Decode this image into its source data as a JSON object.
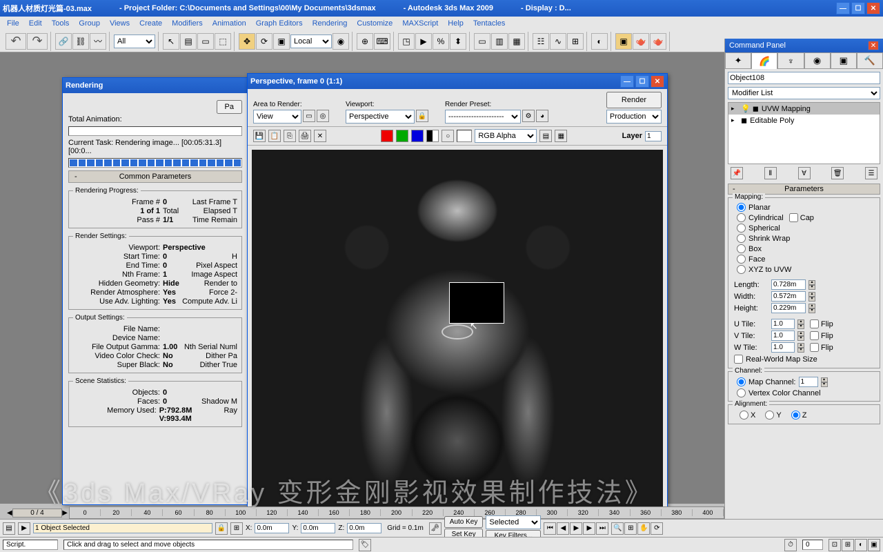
{
  "title": {
    "file": "机器人材质灯光篇-03.max",
    "folder": "- Project Folder: C:\\Documents and Settings\\00\\My Documents\\3dsmax",
    "app": "- Autodesk 3ds Max  2009",
    "display": "- Display : D..."
  },
  "menu": [
    "File",
    "Edit",
    "Tools",
    "Group",
    "Views",
    "Create",
    "Modifiers",
    "Animation",
    "Graph Editors",
    "Rendering",
    "Customize",
    "MAXScript",
    "Help",
    "Tentacles"
  ],
  "toolbar": {
    "sel_filter": "All",
    "coord_sys": "Local"
  },
  "command_panel": {
    "title": "Command Panel",
    "object_name": "Object108",
    "modifier_list": "Modifier List",
    "stack": [
      "UVW Mapping",
      "Editable Poly"
    ],
    "rollout": "Parameters",
    "mapping_label": "Mapping:",
    "mapping_options": [
      "Planar",
      "Cylindrical",
      "Spherical",
      "Shrink Wrap",
      "Box",
      "Face",
      "XYZ to UVW"
    ],
    "cap": "Cap",
    "length_l": "Length:",
    "length_v": "0.728m",
    "width_l": "Width:",
    "width_v": "0.572m",
    "height_l": "Height:",
    "height_v": "0.229m",
    "utile_l": "U Tile:",
    "utile_v": "1.0",
    "vtile_l": "V Tile:",
    "vtile_v": "1.0",
    "wtile_l": "W Tile:",
    "wtile_v": "1.0",
    "flip": "Flip",
    "rwms": "Real-World Map Size",
    "channel_label": "Channel:",
    "map_channel": "Map Channel:",
    "map_channel_v": "1",
    "vertex_color": "Vertex Color Channel",
    "alignment": "Alignment:",
    "axes": [
      "X",
      "Y",
      "Z"
    ]
  },
  "rendering": {
    "title": "Rendering",
    "pause": "Pa",
    "total_anim": "Total Animation:",
    "current_task_l": "Current Task:",
    "current_task_v": "Rendering image... [00:05:31.3] [00:0...",
    "common_params": "Common Parameters",
    "progress_group": "Rendering Progress:",
    "frame_l": "Frame #",
    "frame_v": "0",
    "last_frame": "Last Frame T",
    "of_l": "1 of 1",
    "total_l": "Total",
    "elapsed": "Elapsed T",
    "pass_l": "Pass #",
    "pass_v": "1/1",
    "time_remain": "Time Remain",
    "settings_group": "Render Settings:",
    "viewport_l": "Viewport:",
    "viewport_v": "Perspective",
    "start_l": "Start Time:",
    "start_v": "0",
    "h": "H",
    "end_l": "End Time:",
    "end_v": "0",
    "pixel_aspect": "Pixel Aspect",
    "nth_l": "Nth Frame:",
    "nth_v": "1",
    "image_aspect": "Image Aspect",
    "hidden_l": "Hidden Geometry:",
    "hidden_v": "Hide",
    "render_to": "Render to",
    "atmos_l": "Render Atmosphere:",
    "atmos_v": "Yes",
    "force2": "Force 2-",
    "adv_l": "Use Adv. Lighting:",
    "adv_v": "Yes",
    "compute": "Compute Adv. Li",
    "output_group": "Output Settings:",
    "filename_l": "File Name:",
    "devname_l": "Device Name:",
    "gamma_l": "File Output Gamma:",
    "gamma_v": "1.00",
    "nth_serial": "Nth Serial Numl",
    "vcc_l": "Video Color Check:",
    "vcc_v": "No",
    "dither_p": "Dither Pa",
    "sb_l": "Super Black:",
    "sb_v": "No",
    "dither_t": "Dither True",
    "stats_group": "Scene Statistics:",
    "objects_l": "Objects:",
    "objects_v": "0",
    "faces_l": "Faces:",
    "faces_v": "0",
    "shadow": "Shadow M",
    "mem_l": "Memory Used:",
    "mem_v": "P:792.8M V:993.4M",
    "ray": "Ray"
  },
  "persp": {
    "title": "Perspective, frame 0 (1:1)",
    "render_btn": "Render",
    "area_l": "Area to Render:",
    "area_v": "View",
    "viewport_l": "Viewport:",
    "viewport_v": "Perspective",
    "preset_l": "Render Preset:",
    "preset_v": "----------------------",
    "production": "Production",
    "channel": "RGB Alpha",
    "layer_l": "Layer",
    "layer_v": "1"
  },
  "timeline": {
    "slider": "0 / 4",
    "ticks": [
      "0",
      "20",
      "40",
      "60",
      "80",
      "100",
      "120",
      "140",
      "160",
      "180",
      "200",
      "220",
      "240",
      "260",
      "280",
      "300",
      "320",
      "340",
      "360",
      "380",
      "400"
    ]
  },
  "status": {
    "selected_text": "1 Object Selected",
    "x": "X:",
    "xv": "0.0m",
    "y": "Y:",
    "yv": "0.0m",
    "z": "Z:",
    "zv": "0.0m",
    "grid": "Grid = 0.1m",
    "autokey": "Auto Key",
    "setkey": "Set Key",
    "selected": "Selected",
    "keyfilters": "Key Filters..."
  },
  "bottom": {
    "script": "Script.",
    "hint": "Click and drag to select and move objects"
  },
  "watermark": "《3ds Max/VRay 变形金刚影视效果制作技法》"
}
